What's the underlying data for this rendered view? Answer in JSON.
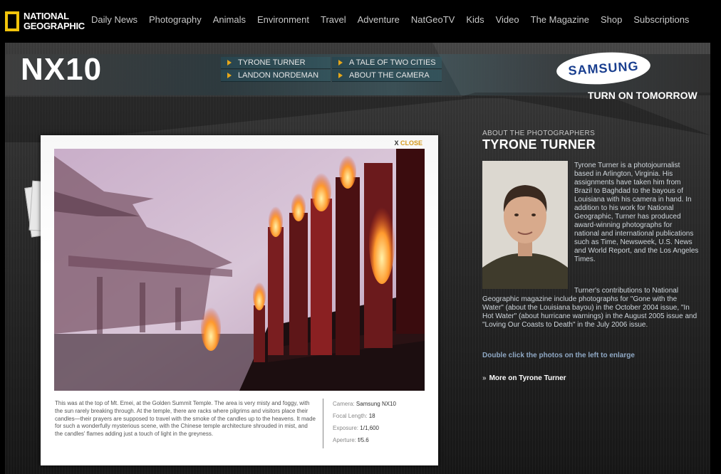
{
  "brand": {
    "logo_line1": "NATIONAL",
    "logo_line2": "GEOGRAPHIC",
    "logo_color": "#f2c40b"
  },
  "nav": {
    "items": [
      {
        "label": "Daily News"
      },
      {
        "label": "Photography"
      },
      {
        "label": "Animals"
      },
      {
        "label": "Environment"
      },
      {
        "label": "Travel"
      },
      {
        "label": "Adventure"
      },
      {
        "label": "NatGeoTV"
      },
      {
        "label": "Kids"
      },
      {
        "label": "Video"
      },
      {
        "label": "The Magazine"
      },
      {
        "label": "Shop"
      },
      {
        "label": "Subscriptions"
      }
    ]
  },
  "banner": {
    "product_logo": "NX10",
    "sub_nav": [
      {
        "label": "TYRONE TURNER"
      },
      {
        "label": "A TALE OF TWO CITIES"
      },
      {
        "label": "LANDON NORDEMAN"
      },
      {
        "label": "ABOUT THE CAMERA"
      }
    ],
    "sponsor": "SAMSUNG",
    "tagline": "TURN ON TOMORROW"
  },
  "popup": {
    "close_x": "X",
    "close_label": "CLOSE",
    "caption": "This was at the top of Mt. Emei, at the Golden Summit Temple. The area is very misty and foggy, with the sun rarely breaking through. At the temple, there are racks where pilgrims and visitors place their candles—their prayers are supposed to travel with the smoke of the candles up to the heavens. It made for such a wonderfully mysterious scene, with the Chinese temple architecture shrouded in mist, and the candles' flames adding just a touch of light in the greyness.",
    "specs": [
      {
        "key": "Camera:",
        "value": "Samsung NX10"
      },
      {
        "key": "Focal Length:",
        "value": "18"
      },
      {
        "key": "Exposure:",
        "value": "1/1,600"
      },
      {
        "key": "Aperture:",
        "value": "f/5.6"
      }
    ]
  },
  "about": {
    "kicker": "ABOUT THE PHOTOGRAPHERS",
    "name": "TYRONE TURNER",
    "bio_1": "Tyrone Turner is a photojournalist based in Arlington, Virginia. His assignments have taken him from Brazil to Baghdad to the bayous of Louisiana with his camera in hand. In addition to his work for National Geographic, Turner has produced award-winning photographs for national and international publications such as Time, Newsweek, U.S. News and World Report, and the Los Angeles Times.",
    "bio_2": "Turner's contributions to National Geographic magazine include photographs for \"Gone with the Water\" (about the Louisiana bayou) in the October 2004 issue, \"In Hot Water\" (about hurricane warnings) in the August 2005 issue and \"Loving Our Coasts to Death\" in the July 2006 issue.",
    "enlarge_hint": "Double click the photos on the left to enlarge",
    "more_chevron": "»",
    "more_link": "More on Tyrone Turner"
  }
}
